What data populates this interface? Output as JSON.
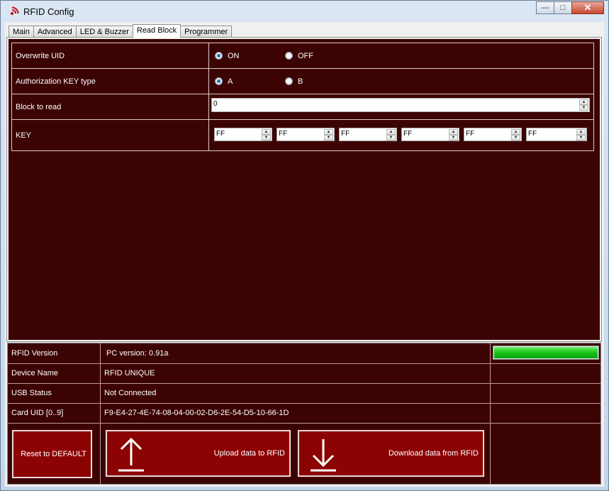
{
  "window": {
    "title": "RFID Config",
    "minimize_glyph": "—",
    "maximize_glyph": "□",
    "close_glyph": "✕"
  },
  "tabs": [
    {
      "label": "Main",
      "active": false
    },
    {
      "label": "Advanced",
      "active": false
    },
    {
      "label": "LED & Buzzer",
      "active": false
    },
    {
      "label": "Read Block",
      "active": true
    },
    {
      "label": "Programmer",
      "active": false
    }
  ],
  "read_block": {
    "overwrite_uid": {
      "label": "Overwrite UID",
      "options": [
        "ON",
        "OFF"
      ],
      "selected": "ON"
    },
    "auth_key_type": {
      "label": "Authorization KEY type",
      "options": [
        "A",
        "B"
      ],
      "selected": "A"
    },
    "block_to_read": {
      "label": "Block to read",
      "value": "0"
    },
    "key": {
      "label": "KEY",
      "bytes": [
        "FF",
        "FF",
        "FF",
        "FF",
        "FF",
        "FF"
      ]
    }
  },
  "status": {
    "rfid_version": {
      "label": "RFID Version",
      "value": "PC version: 0.91a",
      "progress": 1.0
    },
    "device_name": {
      "label": "Device Name",
      "value": "RFID UNIQUE"
    },
    "usb_status": {
      "label": "USB Status",
      "value": "Not Connected"
    },
    "card_uid": {
      "label": "Card UID [0..9]",
      "value": "F9-E4-27-4E-74-08-04-00-02-D6-2E-54-D5-10-66-1D"
    }
  },
  "actions": {
    "reset": "Reset to DEFAULT",
    "upload": "Upload data to RFID",
    "download": "Download data from RFID"
  },
  "colors": {
    "panel_bg": "#3c0303",
    "button_bg": "#8c0303",
    "progress": "#17c317"
  }
}
